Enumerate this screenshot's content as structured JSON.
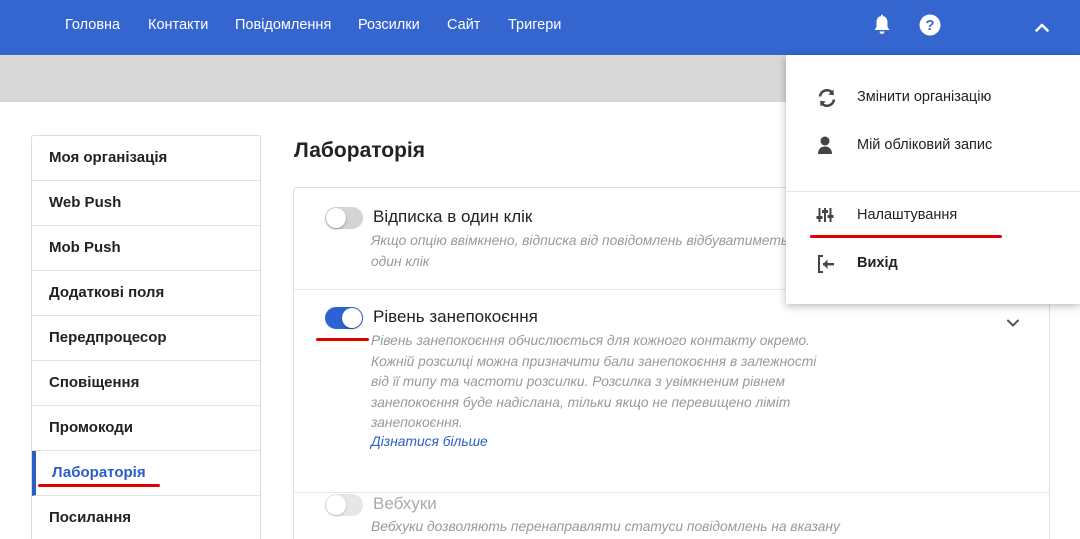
{
  "nav": {
    "items": [
      "Головна",
      "Контакти",
      "Повідомлення",
      "Розсилки",
      "Сайт",
      "Тригери"
    ],
    "icons": [
      "bell-icon",
      "help-icon",
      "chevron-up-icon"
    ]
  },
  "colors": {
    "topbar": "#3566d0",
    "accent": "#2a5dc5",
    "annotation_red": "#e00000",
    "toggle_on": "#2d63d0"
  },
  "sidebar": {
    "items": [
      {
        "label": "Моя організація",
        "active": false
      },
      {
        "label": "Web Push",
        "active": false
      },
      {
        "label": "Mob Push",
        "active": false
      },
      {
        "label": "Додаткові поля",
        "active": false
      },
      {
        "label": "Передпроцесор",
        "active": false
      },
      {
        "label": "Сповіщення",
        "active": false
      },
      {
        "label": "Промокоди",
        "active": false
      },
      {
        "label": "Лабораторія",
        "active": true
      },
      {
        "label": "Посилання",
        "active": false
      }
    ]
  },
  "main": {
    "title": "Лабораторія",
    "features": [
      {
        "title": "Відписка в один клік",
        "enabled": false,
        "description_lines": [
          "Якщо опцію ввімкнено, відписка від повідомлень відбуватиметься в",
          "один клік"
        ]
      },
      {
        "title": "Рівень занепокоєння",
        "enabled": true,
        "description_lines": [
          "Рівень занепокоєння обчислюється для кожного контакту окремо.",
          "Кожній розсилці можна призначити бали занепокоєння в залежності",
          "від її типу та частоти розсилки. Розсилка з увімкненим рівнем",
          "занепокоєння буде надіслана, тільки якщо не перевищено ліміт",
          "занепокоєння."
        ],
        "link": "Дізнатися більше"
      },
      {
        "title": "Вебхуки",
        "enabled": false,
        "disabled": true,
        "description_lines": [
          "Вебхуки дозволяють перенаправляти статуси повідомлень на вказану"
        ]
      }
    ]
  },
  "user_menu": {
    "items": [
      {
        "label": "Змінити організацію",
        "icon": "refresh-icon"
      },
      {
        "label": "Мій обліковий запис",
        "icon": "user-icon"
      },
      {
        "label": "Налаштування",
        "icon": "sliders-icon"
      },
      {
        "label": "Вихід",
        "icon": "logout-icon"
      }
    ]
  }
}
